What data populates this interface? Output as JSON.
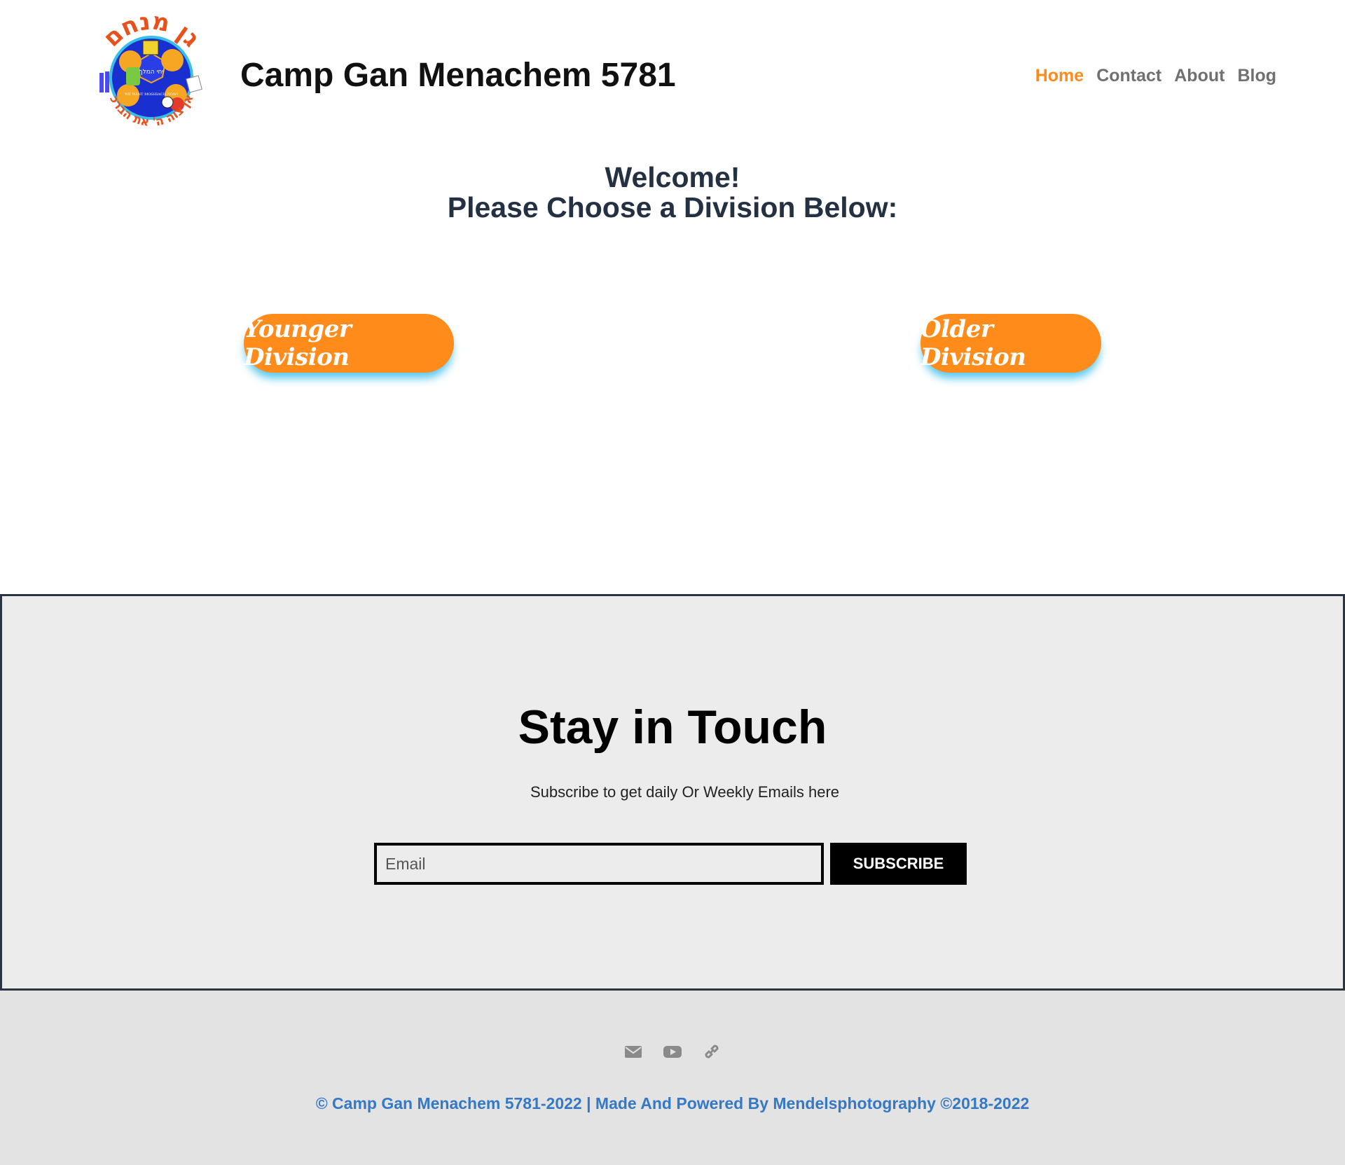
{
  "header": {
    "site_title": "Camp Gan Menachem 5781",
    "logo": {
      "top_text": "גן מנחם",
      "bottom_text": "כאן צוה ה' את הברכה",
      "center_text": "יחי המלך",
      "center_sub": "WE WANT MOSHIACH NOW!"
    },
    "nav": [
      {
        "label": "Home",
        "active": true
      },
      {
        "label": "Contact",
        "active": false
      },
      {
        "label": "About",
        "active": false
      },
      {
        "label": "Blog",
        "active": false
      }
    ]
  },
  "welcome": {
    "line1": "Welcome!",
    "line2": "Please Choose a Division Below:"
  },
  "divisions": {
    "younger": "Younger Division",
    "older": "Older Division"
  },
  "subscribe": {
    "title": "Stay in Touch",
    "subtitle": "Subscribe to get daily Or Weekly Emails here",
    "email_placeholder": "Email",
    "email_value": "",
    "button_label": "SUBSCRIBE"
  },
  "footer": {
    "social_icons": [
      "envelope-icon",
      "youtube-icon",
      "link-icon"
    ],
    "copyright": "© Camp Gan Menachem 5781-2022 | Made And Powered By Mendelsphotography ©2018-2022"
  },
  "colors": {
    "accent_orange": "#ff8c1a",
    "nav_gray": "#707070",
    "heading_navy": "#243142",
    "footer_link_blue": "#3578c4",
    "section_bg": "#ececec",
    "footer_bg": "#e3e3e3"
  }
}
